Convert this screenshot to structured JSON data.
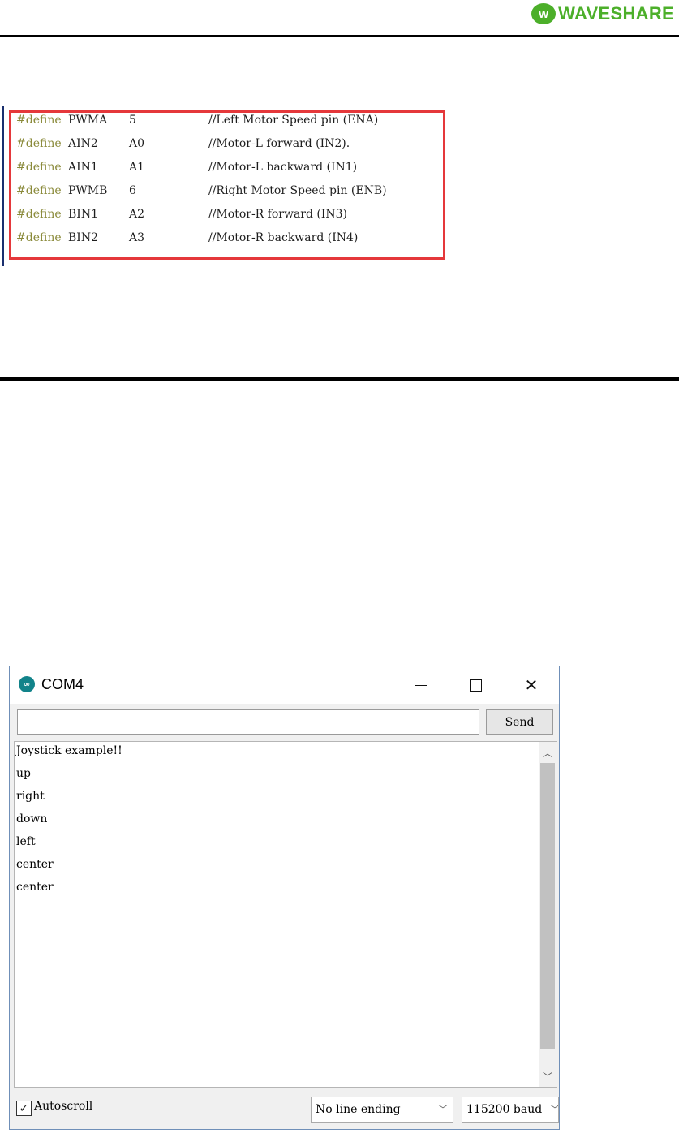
{
  "header": {
    "logo_text": "WAVESHARE",
    "logo_mark": "W"
  },
  "code": {
    "lines": [
      {
        "directive": "#define",
        "name": "PWMA",
        "value": "5",
        "comment": "//Left Motor Speed pin (ENA)"
      },
      {
        "directive": "#define",
        "name": "AIN2",
        "value": "A0",
        "comment": "//Motor-L forward (IN2)."
      },
      {
        "directive": "#define",
        "name": "AIN1",
        "value": "A1",
        "comment": "//Motor-L backward (IN1)"
      },
      {
        "directive": "#define",
        "name": "PWMB",
        "value": "6",
        "comment": "//Right Motor Speed pin (ENB)"
      },
      {
        "directive": "#define",
        "name": "BIN1",
        "value": "A2",
        "comment": "//Motor-R forward (IN3)"
      },
      {
        "directive": "#define",
        "name": "BIN2",
        "value": "A3",
        "comment": "//Motor-R backward (IN4)"
      }
    ],
    "highlight_color": "#e5383b",
    "directive_color": "#8a8a3a"
  },
  "serial_monitor": {
    "title": "COM4",
    "app_icon": "arduino-icon",
    "input_value": "",
    "send_label": "Send",
    "output_lines": [
      "Joystick example!!",
      "up",
      "right",
      "down",
      "left",
      "center",
      "center"
    ],
    "autoscroll_checked": true,
    "autoscroll_label": "Autoscroll",
    "line_ending": "No line ending",
    "baud": "115200 baud"
  }
}
